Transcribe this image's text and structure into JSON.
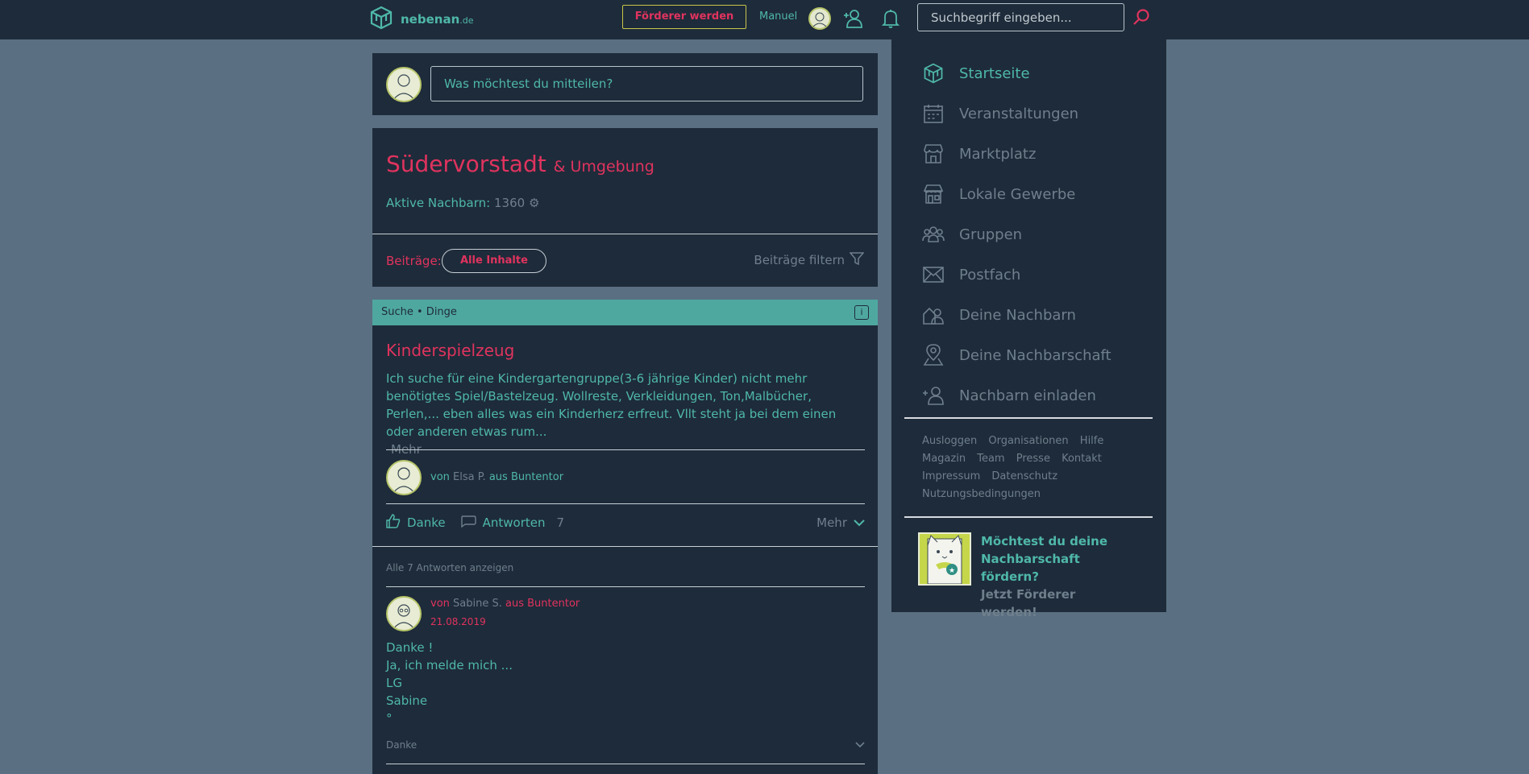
{
  "colors": {
    "accent": "#4fb8a8",
    "brand_red": "#e0335e",
    "panel": "#1e2b3a",
    "background": "#5a6f82",
    "muted": "#6f7f8c"
  },
  "header": {
    "logo_main": "nebenan",
    "logo_suffix": ".de",
    "foerderer_label": "Förderer werden",
    "user_name": "Manuel",
    "search_placeholder": "Suchbegriff eingeben...",
    "icons": [
      "logo-icon",
      "invite-neighbor-icon",
      "bell-icon",
      "search-icon"
    ]
  },
  "composer": {
    "placeholder": "Was möchtest du mitteilen?"
  },
  "neighborhood": {
    "name": "Südervorstadt",
    "suffix": "& Umgebung",
    "active_label": "Aktive Nachbarn:",
    "active_count": "1360",
    "filter_label": "Beiträge:",
    "filter_value": "Alle Inhalte",
    "filter_toggle": "Beiträge filtern"
  },
  "post": {
    "category": "Suche • Dinge",
    "title": "Kinderspielzeug",
    "body": "Ich suche für eine Kindergartengruppe(3-6 jährige Kinder) nicht mehr benötigtes Spiel/Bastelzeug. Wollreste, Verkleidungen, Ton,Malbücher, Perlen,... eben alles was ein Kinderherz erfreut. Vllt steht ja bei dem einen oder anderen etwas rum...",
    "more": "Mehr",
    "author_prefix": "von",
    "author_name": "Elsa P.",
    "author_place": "aus Buntentor",
    "thanks_label": "Danke",
    "reply_label": "Antworten",
    "reply_count": "7",
    "more_label": "Mehr",
    "all_replies": "Alle 7 Antworten anzeigen"
  },
  "reply": {
    "author_prefix": "von",
    "author_name": "Sabine S.",
    "author_place": "aus Buntentor",
    "date": "21.08.2019",
    "lines": [
      "Danke !",
      "Ja, ich melde mich ...",
      "LG",
      "Sabine",
      "°"
    ],
    "thanks": "Danke"
  },
  "sidebar": {
    "items": [
      {
        "label": "Startseite",
        "icon": "home-icon"
      },
      {
        "label": "Veranstaltungen",
        "icon": "calendar-icon"
      },
      {
        "label": "Marktplatz",
        "icon": "market-icon"
      },
      {
        "label": "Lokale Gewerbe",
        "icon": "shop-icon"
      },
      {
        "label": "Gruppen",
        "icon": "groups-icon"
      },
      {
        "label": "Postfach",
        "icon": "mail-icon"
      },
      {
        "label": "Deine Nachbarn",
        "icon": "neighbors-icon"
      },
      {
        "label": "Deine Nachbarschaft",
        "icon": "map-pin-icon"
      },
      {
        "label": "Nachbarn einladen",
        "icon": "invite-icon"
      }
    ],
    "footer_links": [
      "Ausloggen",
      "Organisationen",
      "Hilfe",
      "Magazin",
      "Team",
      "Presse",
      "Kontakt",
      "Impressum",
      "Datenschutz",
      "Nutzungsbedingungen"
    ],
    "promo_line1": "Möchtest du deine Nachbarschaft fördern?",
    "promo_cta": "Jetzt Förderer werden!"
  }
}
